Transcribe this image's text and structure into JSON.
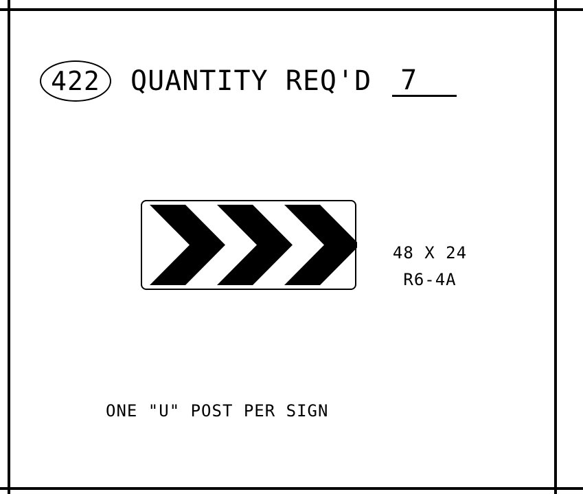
{
  "item_number": "422",
  "header_label": "QUANTITY REQ'D",
  "quantity": "7",
  "sign": {
    "size": "48 X 24",
    "code": "R6-4A",
    "chevron_count": 3,
    "colors": {
      "chevron": "#000000",
      "background": "#ffffff"
    }
  },
  "note": "ONE \"U\" POST PER SIGN"
}
